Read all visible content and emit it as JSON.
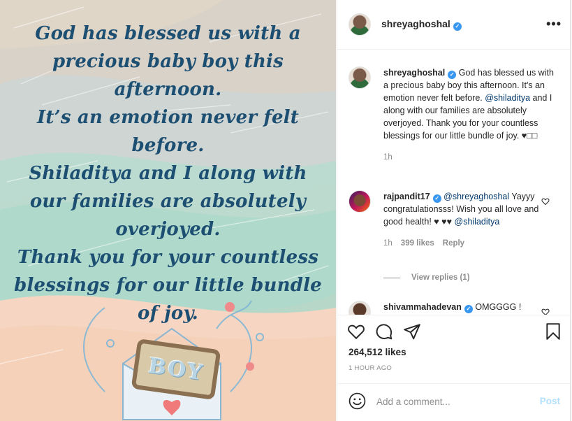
{
  "post_image": {
    "lines": [
      "God has blessed us with a",
      "precious baby boy this",
      "afternoon.",
      "It’s an emotion never felt",
      "before.",
      "Shiladitya and I along with",
      "our families are absolutely",
      "overjoyed.",
      "Thank you for your countless",
      "blessings for our little bundle",
      "of joy."
    ],
    "tag_text": "BOY"
  },
  "header": {
    "username": "shreyaghoshal",
    "verified_icon": "verified-badge-icon",
    "more_icon": "more-options-icon"
  },
  "caption": {
    "username": "shreyaghoshal",
    "text_before": "God has blessed us with a precious baby boy this afternoon. It's an emotion never felt before. ",
    "mention": "@shiladitya",
    "text_after": " and I along with our families are absolutely overjoyed. Thank you for your countless blessings for our little bundle of joy. ♥□□",
    "time": "1h"
  },
  "comments": [
    {
      "username": "rajpandit17",
      "mention1": "@shreyaghoshal",
      "text": " Yayyy congratulationsss! Wish you all love and good health! ♥ ♥♥ ",
      "mention2": "@shiladitya",
      "time": "1h",
      "likes": "399 likes",
      "reply": "Reply"
    },
    {
      "username": "shivammahadevan",
      "text": "OMGGGG !"
    }
  ],
  "view_replies": "View replies (1)",
  "actions": {
    "icons": [
      "heart-icon",
      "comment-icon",
      "share-icon",
      "bookmark-icon"
    ],
    "likes": "264,512 likes",
    "time_ago": "1 HOUR AGO"
  },
  "add_comment": {
    "placeholder": "Add a comment...",
    "post_label": "Post"
  },
  "colors": {
    "verified": "#3897f0",
    "post_disabled": "#b2dffc",
    "image_text": "#1d4f73"
  }
}
